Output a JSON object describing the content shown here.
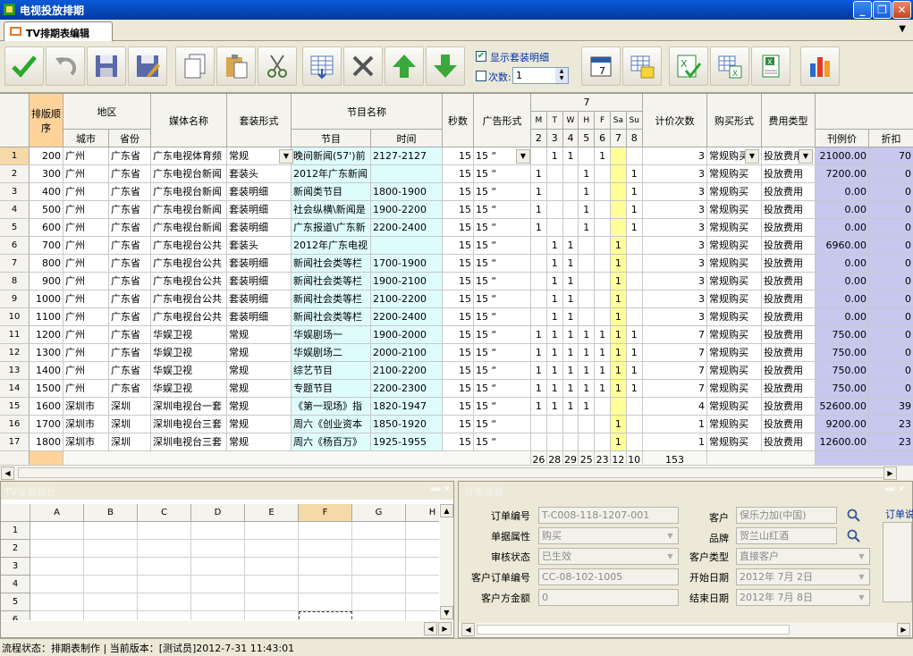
{
  "window": {
    "title": "电视投放排期"
  },
  "tab": {
    "label": "TV排期表编辑"
  },
  "toolbar": {
    "show_package_detail": "显示套装明细",
    "count_label": "次数:",
    "count_value": "1",
    "buttons": [
      "confirm",
      "undo",
      "save",
      "save-as",
      "copy",
      "paste",
      "cut",
      "insert-rows",
      "delete",
      "move-up",
      "move-down",
      "calendar",
      "schedule-grid",
      "excel-approve",
      "excel-export",
      "excel-table",
      "chart"
    ]
  },
  "grid": {
    "headers": {
      "seq": "排版顺序",
      "region": "地区",
      "city": "城市",
      "province": "省份",
      "media": "媒体名称",
      "package": "套装形式",
      "program_group": "节目名称",
      "program": "节目",
      "time": "时间",
      "seconds": "秒数",
      "ad_form": "广告形式",
      "month": "7",
      "weekdays": [
        "M",
        "T",
        "W",
        "H",
        "F",
        "Sa",
        "Su"
      ],
      "dates": [
        "2",
        "3",
        "4",
        "5",
        "6",
        "7",
        "8"
      ],
      "count": "计价次数",
      "buy_form": "购买形式",
      "fee_type": "费用类型",
      "price": "刊例价",
      "discount": "折扣"
    },
    "rows": [
      {
        "n": "1",
        "seq": "200",
        "city": "广州",
        "prov": "广东省",
        "media": "广东电视体育频",
        "pkg": "常规",
        "prog": "晚间新闻(57')前",
        "time": "2127-2127",
        "sec": "15",
        "form": "15 “",
        "days": [
          "",
          "1",
          "1",
          "",
          "1",
          "",
          ""
        ],
        "cnt": "3",
        "buy": "常规购买",
        "fee": "投放费用",
        "price": "21000.00",
        "disc": "70"
      },
      {
        "n": "2",
        "seq": "300",
        "city": "广州",
        "prov": "广东省",
        "media": "广东电视台新闻",
        "pkg": "套装头",
        "prog": "2012年广东新闻",
        "time": "",
        "sec": "15",
        "form": "15 “",
        "days": [
          "1",
          "",
          "",
          "1",
          "",
          "",
          "1"
        ],
        "cnt": "3",
        "buy": "常规购买",
        "fee": "投放费用",
        "price": "7200.00",
        "disc": "0"
      },
      {
        "n": "3",
        "seq": "400",
        "city": "广州",
        "prov": "广东省",
        "media": "广东电视台新闻",
        "pkg": "套装明细",
        "prog": "新闻类节目",
        "time": "1800-1900",
        "sec": "15",
        "form": "15 “",
        "days": [
          "1",
          "",
          "",
          "1",
          "",
          "",
          "1"
        ],
        "cnt": "3",
        "buy": "常规购买",
        "fee": "投放费用",
        "price": "0.00",
        "disc": "0"
      },
      {
        "n": "4",
        "seq": "500",
        "city": "广州",
        "prov": "广东省",
        "media": "广东电视台新闻",
        "pkg": "套装明细",
        "prog": "社会纵横\\新闻是",
        "time": "1900-2200",
        "sec": "15",
        "form": "15 “",
        "days": [
          "1",
          "",
          "",
          "1",
          "",
          "",
          "1"
        ],
        "cnt": "3",
        "buy": "常规购买",
        "fee": "投放费用",
        "price": "0.00",
        "disc": "0"
      },
      {
        "n": "5",
        "seq": "600",
        "city": "广州",
        "prov": "广东省",
        "media": "广东电视台新闻",
        "pkg": "套装明细",
        "prog": "广东报道\\广东新",
        "time": "2200-2400",
        "sec": "15",
        "form": "15 “",
        "days": [
          "1",
          "",
          "",
          "1",
          "",
          "",
          "1"
        ],
        "cnt": "3",
        "buy": "常规购买",
        "fee": "投放费用",
        "price": "0.00",
        "disc": "0"
      },
      {
        "n": "6",
        "seq": "700",
        "city": "广州",
        "prov": "广东省",
        "media": "广东电视台公共",
        "pkg": "套装头",
        "prog": "2012年广东电视",
        "time": "",
        "sec": "15",
        "form": "15 “",
        "days": [
          "",
          "1",
          "1",
          "",
          "",
          "1",
          ""
        ],
        "cnt": "3",
        "buy": "常规购买",
        "fee": "投放费用",
        "price": "6960.00",
        "disc": "0"
      },
      {
        "n": "7",
        "seq": "800",
        "city": "广州",
        "prov": "广东省",
        "media": "广东电视台公共",
        "pkg": "套装明细",
        "prog": "新闻社会类等栏",
        "time": "1700-1900",
        "sec": "15",
        "form": "15 “",
        "days": [
          "",
          "1",
          "1",
          "",
          "",
          "1",
          ""
        ],
        "cnt": "3",
        "buy": "常规购买",
        "fee": "投放费用",
        "price": "0.00",
        "disc": "0"
      },
      {
        "n": "8",
        "seq": "900",
        "city": "广州",
        "prov": "广东省",
        "media": "广东电视台公共",
        "pkg": "套装明细",
        "prog": "新闻社会类等栏",
        "time": "1900-2100",
        "sec": "15",
        "form": "15 “",
        "days": [
          "",
          "1",
          "1",
          "",
          "",
          "1",
          ""
        ],
        "cnt": "3",
        "buy": "常规购买",
        "fee": "投放费用",
        "price": "0.00",
        "disc": "0"
      },
      {
        "n": "9",
        "seq": "1000",
        "city": "广州",
        "prov": "广东省",
        "media": "广东电视台公共",
        "pkg": "套装明细",
        "prog": "新闻社会类等栏",
        "time": "2100-2200",
        "sec": "15",
        "form": "15 “",
        "days": [
          "",
          "1",
          "1",
          "",
          "",
          "1",
          ""
        ],
        "cnt": "3",
        "buy": "常规购买",
        "fee": "投放费用",
        "price": "0.00",
        "disc": "0"
      },
      {
        "n": "10",
        "seq": "1100",
        "city": "广州",
        "prov": "广东省",
        "media": "广东电视台公共",
        "pkg": "套装明细",
        "prog": "新闻社会类等栏",
        "time": "2200-2400",
        "sec": "15",
        "form": "15 “",
        "days": [
          "",
          "1",
          "1",
          "",
          "",
          "1",
          ""
        ],
        "cnt": "3",
        "buy": "常规购买",
        "fee": "投放费用",
        "price": "0.00",
        "disc": "0"
      },
      {
        "n": "11",
        "seq": "1200",
        "city": "广州",
        "prov": "广东省",
        "media": "华娱卫视",
        "pkg": "常规",
        "prog": "华娱剧场一",
        "time": "1900-2000",
        "sec": "15",
        "form": "15 “",
        "days": [
          "1",
          "1",
          "1",
          "1",
          "1",
          "1",
          "1"
        ],
        "cnt": "7",
        "buy": "常规购买",
        "fee": "投放费用",
        "price": "750.00",
        "disc": "0"
      },
      {
        "n": "12",
        "seq": "1300",
        "city": "广州",
        "prov": "广东省",
        "media": "华娱卫视",
        "pkg": "常规",
        "prog": "华娱剧场二",
        "time": "2000-2100",
        "sec": "15",
        "form": "15 “",
        "days": [
          "1",
          "1",
          "1",
          "1",
          "1",
          "1",
          "1"
        ],
        "cnt": "7",
        "buy": "常规购买",
        "fee": "投放费用",
        "price": "750.00",
        "disc": "0"
      },
      {
        "n": "13",
        "seq": "1400",
        "city": "广州",
        "prov": "广东省",
        "media": "华娱卫视",
        "pkg": "常规",
        "prog": "综艺节目",
        "time": "2100-2200",
        "sec": "15",
        "form": "15 “",
        "days": [
          "1",
          "1",
          "1",
          "1",
          "1",
          "1",
          "1"
        ],
        "cnt": "7",
        "buy": "常规购买",
        "fee": "投放费用",
        "price": "750.00",
        "disc": "0"
      },
      {
        "n": "14",
        "seq": "1500",
        "city": "广州",
        "prov": "广东省",
        "media": "华娱卫视",
        "pkg": "常规",
        "prog": "专题节目",
        "time": "2200-2300",
        "sec": "15",
        "form": "15 “",
        "days": [
          "1",
          "1",
          "1",
          "1",
          "1",
          "1",
          "1"
        ],
        "cnt": "7",
        "buy": "常规购买",
        "fee": "投放费用",
        "price": "750.00",
        "disc": "0"
      },
      {
        "n": "15",
        "seq": "1600",
        "city": "深圳市",
        "prov": "深圳",
        "media": "深圳电视台一套",
        "pkg": "常规",
        "prog": "《第一现场》指",
        "time": "1820-1947",
        "sec": "15",
        "form": "15 “",
        "days": [
          "1",
          "1",
          "1",
          "1",
          "",
          "",
          ""
        ],
        "cnt": "4",
        "buy": "常规购买",
        "fee": "投放费用",
        "price": "52600.00",
        "disc": "39"
      },
      {
        "n": "16",
        "seq": "1700",
        "city": "深圳市",
        "prov": "深圳",
        "media": "深圳电视台三套",
        "pkg": "常规",
        "prog": "周六《创业资本",
        "time": "1850-1920",
        "sec": "15",
        "form": "15 “",
        "days": [
          "",
          "",
          "",
          "",
          "",
          "1",
          ""
        ],
        "cnt": "1",
        "buy": "常规购买",
        "fee": "投放费用",
        "price": "9200.00",
        "disc": "23"
      },
      {
        "n": "17",
        "seq": "1800",
        "city": "深圳市",
        "prov": "深圳",
        "media": "深圳电视台三套",
        "pkg": "常规",
        "prog": "周六《杨百万》",
        "time": "1925-1955",
        "sec": "15",
        "form": "15 “",
        "days": [
          "",
          "",
          "",
          "",
          "",
          "1",
          ""
        ],
        "cnt": "1",
        "buy": "常规购买",
        "fee": "投放费用",
        "price": "12600.00",
        "disc": "23"
      }
    ],
    "totals": {
      "days": [
        "26",
        "28",
        "29",
        "25",
        "23",
        "12",
        "10"
      ],
      "count": "153"
    }
  },
  "stats_panel": {
    "title": "TV信息统计",
    "columns": [
      "A",
      "B",
      "C",
      "D",
      "E",
      "F",
      "G",
      "H"
    ],
    "rows": [
      "1",
      "2",
      "3",
      "4",
      "5",
      "6"
    ]
  },
  "order_panel": {
    "title": "订单信息",
    "order_no_label": "订单编号",
    "order_no": "T-C008-118-1207-001",
    "doc_attr_label": "单据属性",
    "doc_attr": "购买",
    "audit_label": "审核状态",
    "audit": "已生效",
    "client_order_label": "客户订单编号",
    "client_order": "CC-08-102-1005",
    "client_amount_label": "客户方金额",
    "client_amount": "0",
    "client_label": "客户",
    "client": "保乐力加(中国)",
    "brand_label": "品牌",
    "brand": "贺兰山红酒",
    "client_type_label": "客户类型",
    "client_type": "直接客户",
    "start_label": "开始日期",
    "start": "2012年 7月 2日",
    "end_label": "结束日期",
    "end": "2012年 7月 8日",
    "remark_label": "订单说"
  },
  "status": {
    "text": "流程状态：排期表制作 | 当前版本：[测试员]2012-7-31 11:43:01"
  },
  "colors": {
    "titlebar": "#0846b8",
    "cyan": "#dffcfc",
    "yellow": "#ffff99",
    "lavender": "#c6c8ee",
    "seq_header": "#ffd39a"
  }
}
